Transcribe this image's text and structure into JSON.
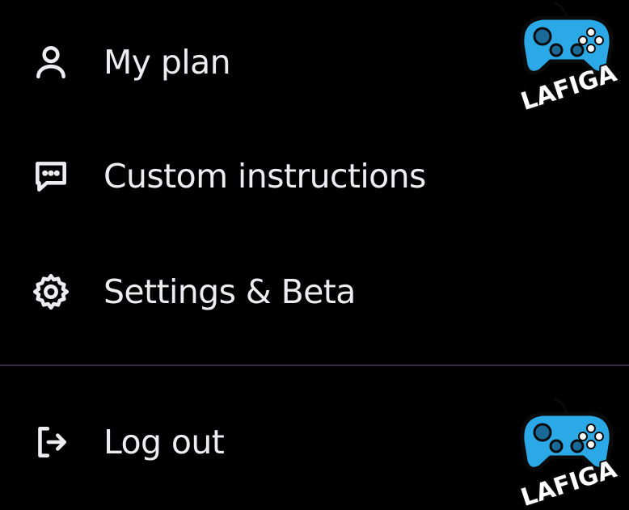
{
  "menu": {
    "items": [
      {
        "label": "My plan",
        "icon": "user-icon"
      },
      {
        "label": "Custom instructions",
        "icon": "chat-bubble-icon"
      },
      {
        "label": "Settings & Beta",
        "icon": "gear-icon"
      },
      {
        "label": "Log out",
        "icon": "logout-icon"
      }
    ]
  },
  "watermark": {
    "text": "LAFIGA",
    "colors": {
      "controller": "#2aa9e6",
      "outline": "#0a0a0a",
      "text_fill": "#ffffff"
    }
  },
  "colors": {
    "background": "#000000",
    "text": "#ececf1",
    "divider": "#3a2a44"
  }
}
